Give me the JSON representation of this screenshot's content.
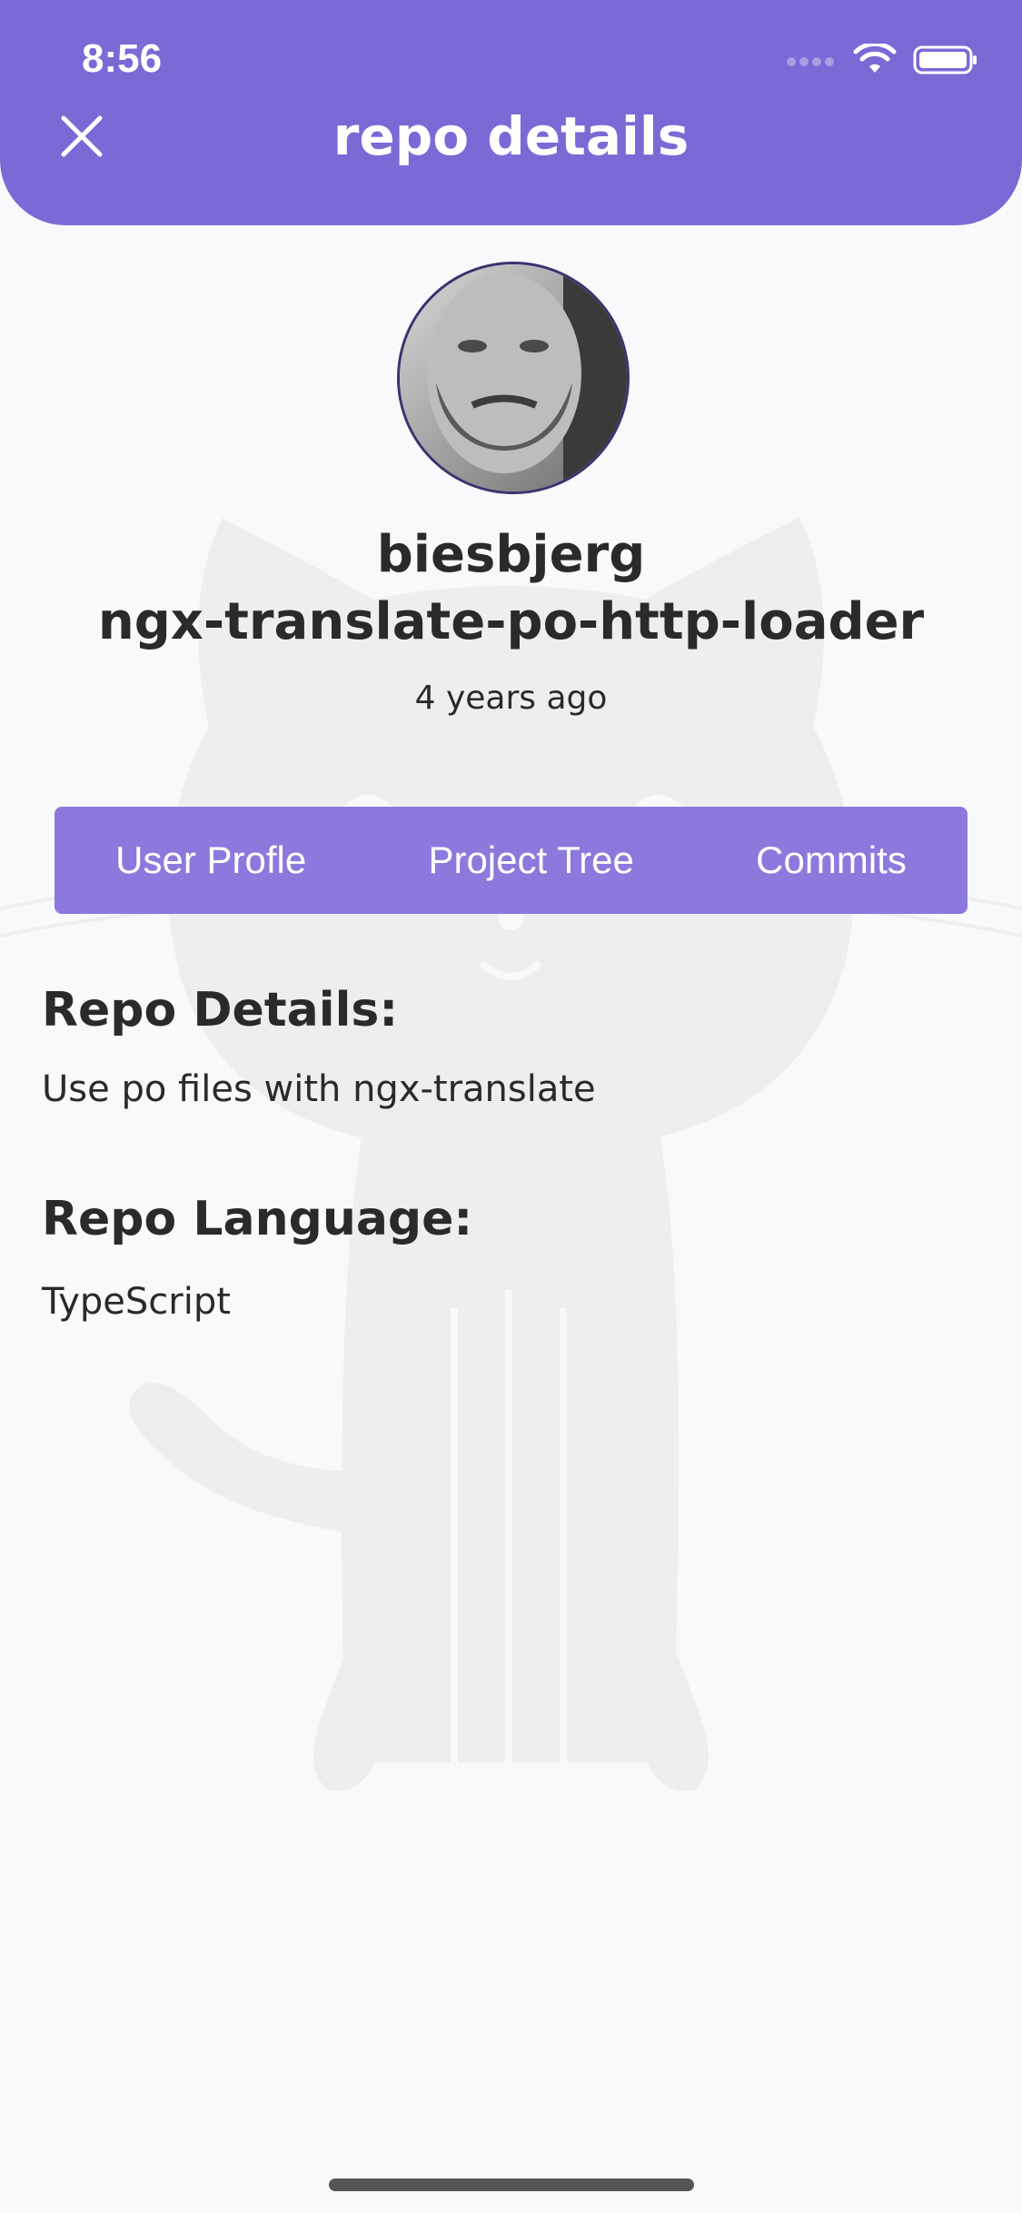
{
  "status_bar": {
    "time": "8:56"
  },
  "header": {
    "title": "repo details",
    "close_icon": "close-icon"
  },
  "repo": {
    "owner": "biesbjerg",
    "name": "ngx-translate-po-http-loader",
    "age": "4 years ago"
  },
  "tabs": [
    {
      "label": "User Profle"
    },
    {
      "label": "Project Tree"
    },
    {
      "label": "Commits"
    }
  ],
  "details": {
    "description_title": "Repo Details:",
    "description": "Use po files with ngx-translate",
    "language_title": "Repo Language:",
    "language": "TypeScript"
  },
  "colors": {
    "accent": "#7b69d6",
    "tab_bar": "#8d79dd",
    "background": "#f8f9fb"
  }
}
